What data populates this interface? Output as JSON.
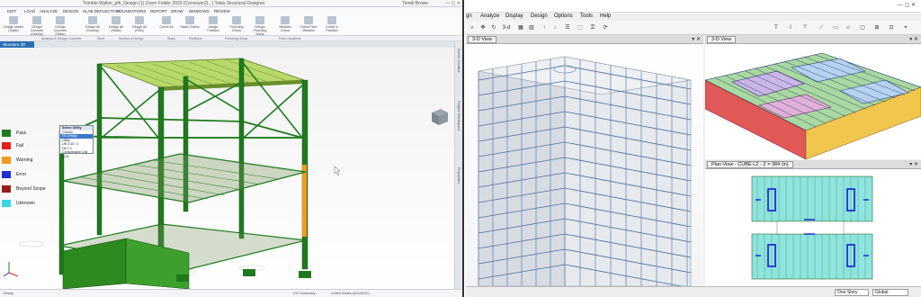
{
  "tekla": {
    "title": "Trimble Walkin_pth_Design (1) Zoom Folder 2023 (Conveyor2)...) Tekla Structural Designer",
    "user": "Trimbl Brown",
    "tabs": [
      "EDIT",
      "LOAD",
      "ANALYZE",
      "DESIGN",
      "SLAB DEFLECTION",
      "FOUNDATIONS",
      "REPORT",
      "DRAW",
      "WINDOWS",
      "REVIEW"
    ],
    "ribbon_buttons": [
      "Design Model (Static)",
      "Design Concrete (Gravity)",
      "Design Concrete (Static)",
      "Design All (Gravity)",
      "Design All (Static)",
      "Design All (RSA)",
      "Check All",
      "Static Chains",
      "Assign Partition",
      "Punching Check",
      "Design Punching Shear",
      "Vibration Check",
      "Check Floor Vibration",
      "Check in Partition"
    ],
    "groups": [
      "Analysis & Design Concrete",
      "Steel",
      "Section & Design",
      "Slabs",
      "Partitions",
      "Punching Shear",
      "Floor vibrations"
    ],
    "view_tab": "Structure 3D",
    "side_tabs": [
      "Scene Content",
      "Project Workspace",
      "Properties"
    ],
    "popup": {
      "header": "Select Utility",
      "rows": [
        "Checks",
        "No Design",
        "Utility",
        "UB 3-45 / 1",
        "Dir 1.0",
        "Compressive Unit (1.0)"
      ],
      "selected_index": 1
    },
    "legend": [
      {
        "label": "Pass",
        "color": "#1f7a1f"
      },
      {
        "label": "Fail",
        "color": "#e51e1e"
      },
      {
        "label": "Warning",
        "color": "#f39a1e"
      },
      {
        "label": "Error",
        "color": "#1f2fd6"
      },
      {
        "label": "Beyond Scope",
        "color": "#9b1b1b"
      },
      {
        "label": "Unknown",
        "color": "#35d6e6"
      }
    ],
    "status": [
      "Ready",
      "US Customary",
      "United States (ACI/AISC)"
    ]
  },
  "etabs": {
    "menus": [
      "gn",
      "Analyze",
      "Display",
      "Design",
      "Options",
      "Tools",
      "Help"
    ],
    "views": {
      "left": "3-D View",
      "top_right": "3-D View",
      "bottom_right": "Plan View - CUBE-L2 - Z = 384 (in)"
    },
    "story_combo": "One Story",
    "coord_combo": "Global",
    "toolbar_text": "3-d"
  }
}
